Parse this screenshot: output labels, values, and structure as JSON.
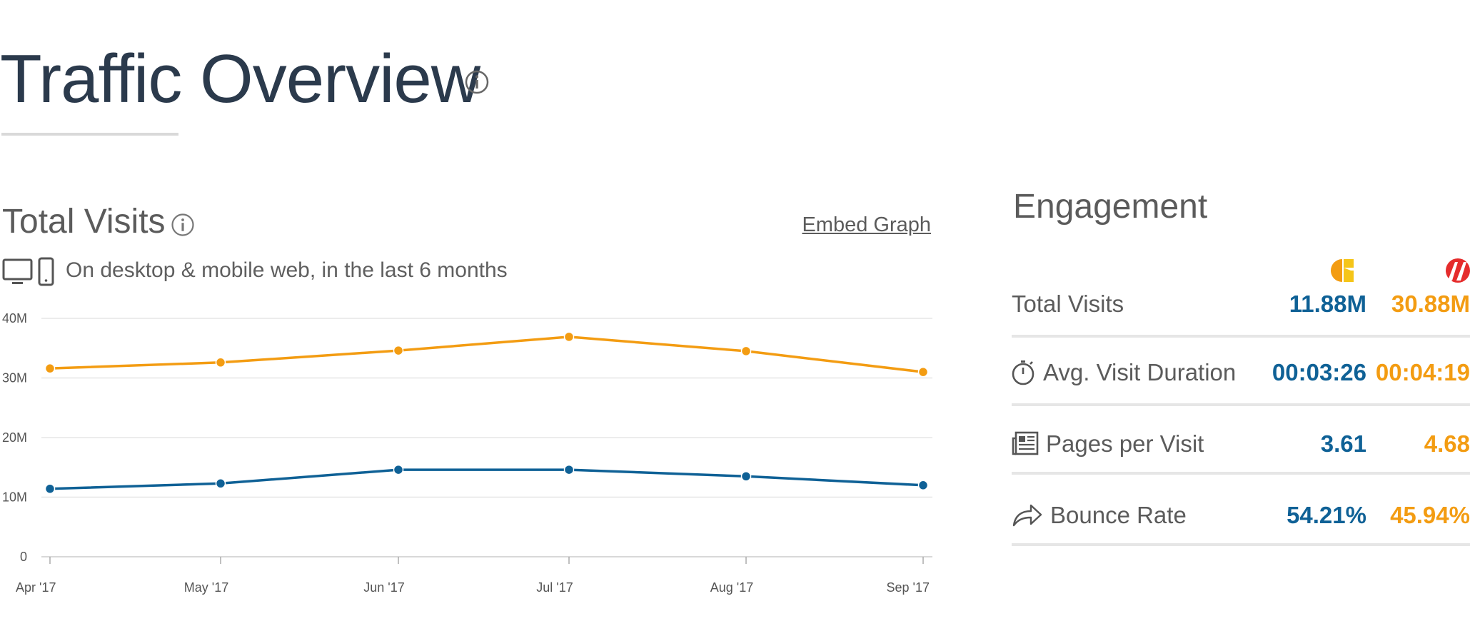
{
  "page": {
    "title": "Traffic Overview"
  },
  "total_visits_section": {
    "title": "Total Visits",
    "embed_label": "Embed Graph",
    "subtitle": "On desktop & mobile web, in the last 6 months"
  },
  "chart_data": {
    "type": "line",
    "x": [
      "Apr '17",
      "May '17",
      "Jun '17",
      "Jul '17",
      "Aug '17",
      "Sep '17"
    ],
    "y_ticks": [
      "0",
      "10M",
      "20M",
      "30M",
      "40M"
    ],
    "ylim": [
      0,
      40000000
    ],
    "grid": true,
    "series": [
      {
        "color": "#f39c12",
        "values": [
          31600000,
          32600000,
          34600000,
          36900000,
          34500000,
          31000000
        ]
      },
      {
        "color": "#0f6196",
        "values": [
          11400000,
          12300000,
          14600000,
          14600000,
          13500000,
          12000000
        ]
      }
    ]
  },
  "engagement": {
    "title": "Engagement",
    "sites": [
      {
        "icon": "site-logo-orange-yellow",
        "color": "#f39c12"
      },
      {
        "icon": "site-logo-red",
        "color": "#e52c2c"
      }
    ],
    "rows": [
      {
        "label": "Total Visits",
        "icon": "",
        "site1": "11.88M",
        "site2": "30.88M"
      },
      {
        "label": "Avg. Visit Duration",
        "icon": "stopwatch-icon",
        "site1": "00:03:26",
        "site2": "00:04:19"
      },
      {
        "label": "Pages per Visit",
        "icon": "newspaper-icon",
        "site1": "3.61",
        "site2": "4.68"
      },
      {
        "label": "Bounce Rate",
        "icon": "share-arrow-icon",
        "site1": "54.21%",
        "site2": "45.94%"
      }
    ]
  },
  "colors": {
    "blue": "#0f6196",
    "orange": "#f39c12",
    "title": "#2b3a4c"
  }
}
